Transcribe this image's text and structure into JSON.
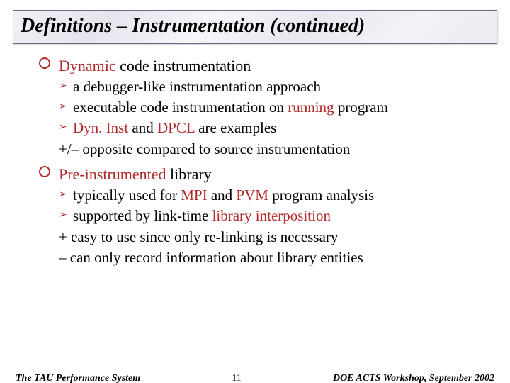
{
  "title": "Definitions – Instrumentation (continued)",
  "section1": {
    "heading_red": "Dynamic",
    "heading_rest": " code instrumentation",
    "items": [
      {
        "text": "a debugger-like instrumentation approach"
      },
      {
        "text_pre": "executable code instrumentation on ",
        "red": "running",
        "text_post": " program"
      },
      {
        "red1": "Dyn. Inst",
        "mid": " and ",
        "red2": "DPCL",
        "post": " are examples"
      }
    ],
    "plain": "+/– opposite compared to source instrumentation"
  },
  "section2": {
    "heading_red": "Pre-instrumented",
    "heading_rest": " library",
    "items": [
      {
        "text_pre": "typically used for ",
        "red1": "MPI",
        "mid": " and ",
        "red2": "PVM",
        "post": " program analysis"
      },
      {
        "text_pre": "supported by link-time ",
        "red": "library interposition"
      }
    ],
    "plain1": "+ easy to use since only re-linking is necessary",
    "plain2": "– can only record information about library entities"
  },
  "footer": {
    "left": "The TAU Performance System",
    "center": "11",
    "right": "DOE ACTS Workshop, September 2002"
  }
}
